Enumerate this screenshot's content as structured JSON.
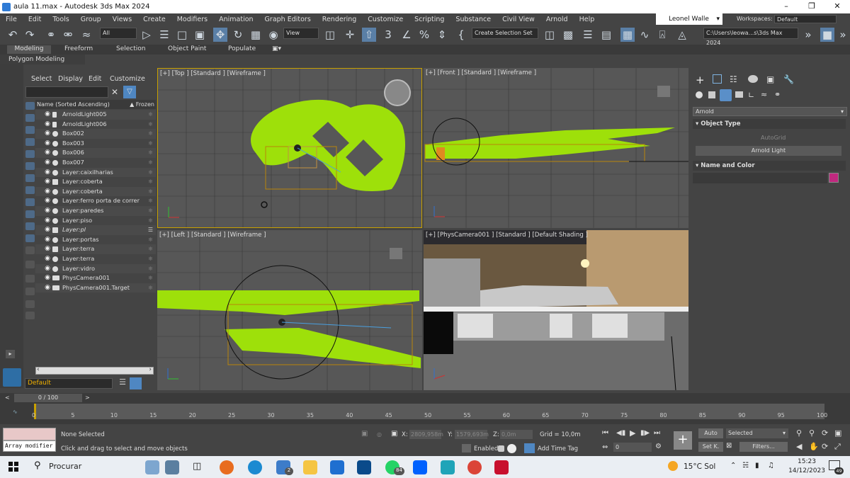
{
  "window": {
    "title": "aula 11.max - Autodesk 3ds Max 2024"
  },
  "menu": [
    "File",
    "Edit",
    "Tools",
    "Group",
    "Views",
    "Create",
    "Modifiers",
    "Animation",
    "Graph Editors",
    "Rendering",
    "Customize",
    "Scripting",
    "Substance",
    "Civil View",
    "Arnold",
    "Help"
  ],
  "user": "Leonel Walle",
  "workspaces": {
    "label": "Workspaces:",
    "value": "Default"
  },
  "toolbar": {
    "filter": "All",
    "refcoord": "View",
    "selset": "Create Selection Set",
    "path": "C:\\Users\\leowa...s\\3ds Max 2024"
  },
  "ribbon": {
    "tabs": [
      "Modeling",
      "Freeform",
      "Selection",
      "Object Paint",
      "Populate"
    ],
    "subtitle": "Polygon Modeling"
  },
  "scene_explorer": {
    "menu": [
      "Select",
      "Display",
      "Edit",
      "Customize"
    ],
    "column_name": "Name (Sorted Ascending)",
    "column_frozen": "▲ Frozen",
    "items": [
      {
        "name": "ArnoldLight005",
        "type": "light"
      },
      {
        "name": "ArnoldLight006",
        "type": "light"
      },
      {
        "name": "Box002",
        "type": "geo"
      },
      {
        "name": "Box003",
        "type": "geo"
      },
      {
        "name": "Box006",
        "type": "geo"
      },
      {
        "name": "Box007",
        "type": "geo"
      },
      {
        "name": "Layer:caixilharias",
        "type": "layer"
      },
      {
        "name": "Layer:coberta",
        "type": "layerstack"
      },
      {
        "name": "Layer:coberta",
        "type": "layer"
      },
      {
        "name": "Layer:ferro porta de correr",
        "type": "layer"
      },
      {
        "name": "Layer:paredes",
        "type": "layer"
      },
      {
        "name": "Layer:piso",
        "type": "layer"
      },
      {
        "name": "Layer:pl",
        "type": "layerstack"
      },
      {
        "name": "Layer:portas",
        "type": "layer"
      },
      {
        "name": "Layer:terra",
        "type": "layerstack"
      },
      {
        "name": "Layer:terra",
        "type": "layer"
      },
      {
        "name": "Layer:vidro",
        "type": "layer"
      },
      {
        "name": "PhysCamera001",
        "type": "camera"
      },
      {
        "name": "PhysCamera001.Target",
        "type": "camera"
      }
    ],
    "layer_box": "Default"
  },
  "viewports": {
    "top": "[+] [Top ] [Standard ] [Wireframe ]",
    "front": "[+] [Front ] [Standard ] [Wireframe ]",
    "left": "[+] [Left ] [Standard ] [Wireframe ]",
    "camera": "[+] [PhysCamera001 ] [Standard ] [Default Shading ]"
  },
  "command_panel": {
    "renderer": "Arnold",
    "object_type": "Object Type",
    "autogrid": "AutoGrid",
    "arnold_light": "Arnold Light",
    "name_color": "Name and Color",
    "swatch": "#c0297f"
  },
  "timeline": {
    "frame": "0 / 100",
    "ticks": [
      "0",
      "5",
      "10",
      "15",
      "20",
      "25",
      "30",
      "35",
      "40",
      "45",
      "50",
      "55",
      "60",
      "65",
      "70",
      "75",
      "80",
      "85",
      "90",
      "95",
      "100"
    ]
  },
  "status": {
    "script": "Array modifier",
    "selection": "None Selected",
    "hint": "Click and drag to select and move objects",
    "x": "2809,958m",
    "y": "1579,693m",
    "z": "0,0m",
    "grid": "Grid = 10,0m",
    "enabled": "Enabled:",
    "timetag": "Add Time Tag",
    "auto": "Auto",
    "setk": "Set K.",
    "selected": "Selected",
    "filters": "Filters...",
    "frame_field": "0",
    "labels": {
      "x": "X:",
      "y": "Y:",
      "z": "Z:"
    }
  },
  "taskbar": {
    "search": "Procurar",
    "weather": "15°C  Sol",
    "time": "15:23",
    "date": "14/12/2023",
    "badge_mail": "2",
    "badge_whatsapp": "84",
    "notif": "49"
  },
  "colors": {
    "wire": "#9ee00a",
    "accent": "#5aa0e0",
    "panel": "#444444"
  }
}
